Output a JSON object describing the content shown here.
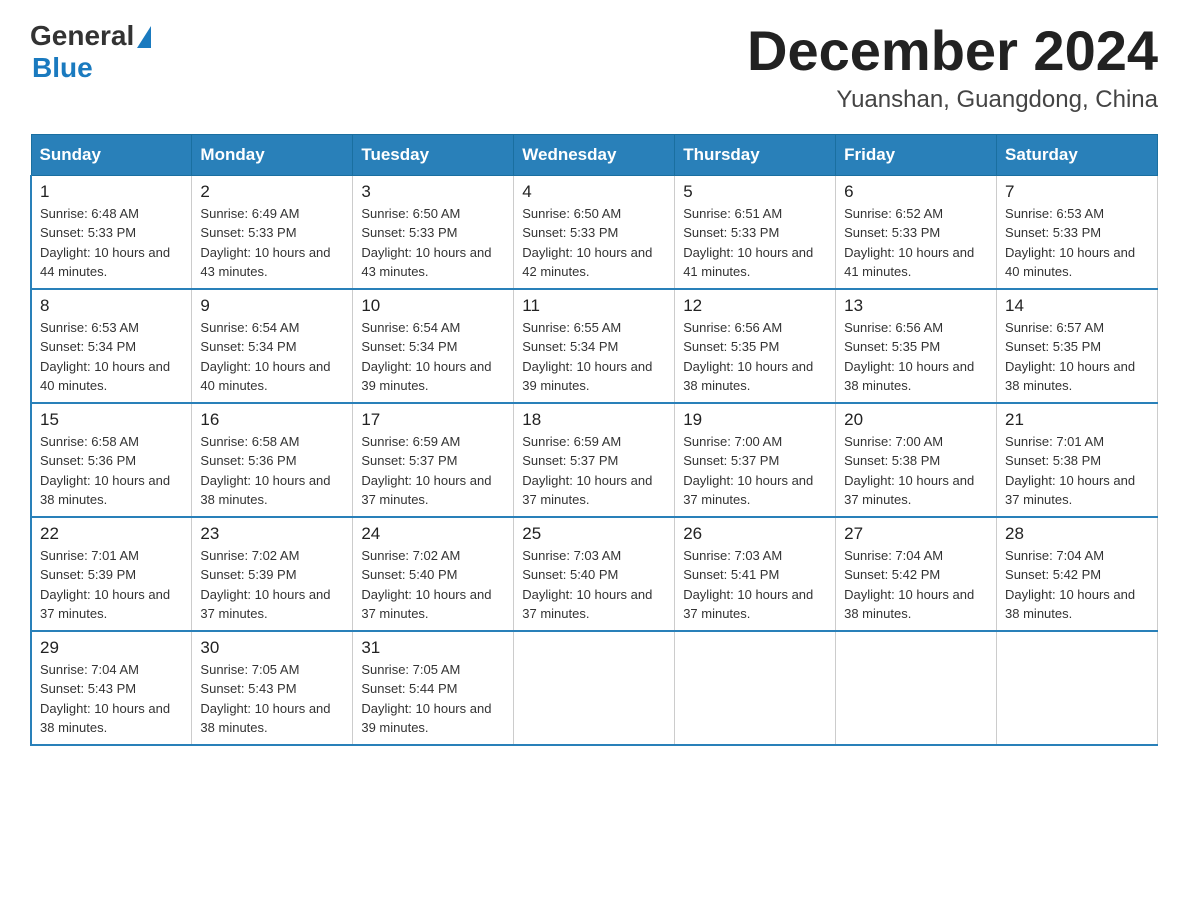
{
  "header": {
    "logo_general": "General",
    "logo_blue": "Blue",
    "month_title": "December 2024",
    "location": "Yuanshan, Guangdong, China"
  },
  "weekdays": [
    "Sunday",
    "Monday",
    "Tuesday",
    "Wednesday",
    "Thursday",
    "Friday",
    "Saturday"
  ],
  "weeks": [
    [
      {
        "day": "1",
        "sunrise": "6:48 AM",
        "sunset": "5:33 PM",
        "daylight": "10 hours and 44 minutes."
      },
      {
        "day": "2",
        "sunrise": "6:49 AM",
        "sunset": "5:33 PM",
        "daylight": "10 hours and 43 minutes."
      },
      {
        "day": "3",
        "sunrise": "6:50 AM",
        "sunset": "5:33 PM",
        "daylight": "10 hours and 43 minutes."
      },
      {
        "day": "4",
        "sunrise": "6:50 AM",
        "sunset": "5:33 PM",
        "daylight": "10 hours and 42 minutes."
      },
      {
        "day": "5",
        "sunrise": "6:51 AM",
        "sunset": "5:33 PM",
        "daylight": "10 hours and 41 minutes."
      },
      {
        "day": "6",
        "sunrise": "6:52 AM",
        "sunset": "5:33 PM",
        "daylight": "10 hours and 41 minutes."
      },
      {
        "day": "7",
        "sunrise": "6:53 AM",
        "sunset": "5:33 PM",
        "daylight": "10 hours and 40 minutes."
      }
    ],
    [
      {
        "day": "8",
        "sunrise": "6:53 AM",
        "sunset": "5:34 PM",
        "daylight": "10 hours and 40 minutes."
      },
      {
        "day": "9",
        "sunrise": "6:54 AM",
        "sunset": "5:34 PM",
        "daylight": "10 hours and 40 minutes."
      },
      {
        "day": "10",
        "sunrise": "6:54 AM",
        "sunset": "5:34 PM",
        "daylight": "10 hours and 39 minutes."
      },
      {
        "day": "11",
        "sunrise": "6:55 AM",
        "sunset": "5:34 PM",
        "daylight": "10 hours and 39 minutes."
      },
      {
        "day": "12",
        "sunrise": "6:56 AM",
        "sunset": "5:35 PM",
        "daylight": "10 hours and 38 minutes."
      },
      {
        "day": "13",
        "sunrise": "6:56 AM",
        "sunset": "5:35 PM",
        "daylight": "10 hours and 38 minutes."
      },
      {
        "day": "14",
        "sunrise": "6:57 AM",
        "sunset": "5:35 PM",
        "daylight": "10 hours and 38 minutes."
      }
    ],
    [
      {
        "day": "15",
        "sunrise": "6:58 AM",
        "sunset": "5:36 PM",
        "daylight": "10 hours and 38 minutes."
      },
      {
        "day": "16",
        "sunrise": "6:58 AM",
        "sunset": "5:36 PM",
        "daylight": "10 hours and 38 minutes."
      },
      {
        "day": "17",
        "sunrise": "6:59 AM",
        "sunset": "5:37 PM",
        "daylight": "10 hours and 37 minutes."
      },
      {
        "day": "18",
        "sunrise": "6:59 AM",
        "sunset": "5:37 PM",
        "daylight": "10 hours and 37 minutes."
      },
      {
        "day": "19",
        "sunrise": "7:00 AM",
        "sunset": "5:37 PM",
        "daylight": "10 hours and 37 minutes."
      },
      {
        "day": "20",
        "sunrise": "7:00 AM",
        "sunset": "5:38 PM",
        "daylight": "10 hours and 37 minutes."
      },
      {
        "day": "21",
        "sunrise": "7:01 AM",
        "sunset": "5:38 PM",
        "daylight": "10 hours and 37 minutes."
      }
    ],
    [
      {
        "day": "22",
        "sunrise": "7:01 AM",
        "sunset": "5:39 PM",
        "daylight": "10 hours and 37 minutes."
      },
      {
        "day": "23",
        "sunrise": "7:02 AM",
        "sunset": "5:39 PM",
        "daylight": "10 hours and 37 minutes."
      },
      {
        "day": "24",
        "sunrise": "7:02 AM",
        "sunset": "5:40 PM",
        "daylight": "10 hours and 37 minutes."
      },
      {
        "day": "25",
        "sunrise": "7:03 AM",
        "sunset": "5:40 PM",
        "daylight": "10 hours and 37 minutes."
      },
      {
        "day": "26",
        "sunrise": "7:03 AM",
        "sunset": "5:41 PM",
        "daylight": "10 hours and 37 minutes."
      },
      {
        "day": "27",
        "sunrise": "7:04 AM",
        "sunset": "5:42 PM",
        "daylight": "10 hours and 38 minutes."
      },
      {
        "day": "28",
        "sunrise": "7:04 AM",
        "sunset": "5:42 PM",
        "daylight": "10 hours and 38 minutes."
      }
    ],
    [
      {
        "day": "29",
        "sunrise": "7:04 AM",
        "sunset": "5:43 PM",
        "daylight": "10 hours and 38 minutes."
      },
      {
        "day": "30",
        "sunrise": "7:05 AM",
        "sunset": "5:43 PM",
        "daylight": "10 hours and 38 minutes."
      },
      {
        "day": "31",
        "sunrise": "7:05 AM",
        "sunset": "5:44 PM",
        "daylight": "10 hours and 39 minutes."
      },
      null,
      null,
      null,
      null
    ]
  ],
  "labels": {
    "sunrise": "Sunrise:",
    "sunset": "Sunset:",
    "daylight": "Daylight:"
  }
}
